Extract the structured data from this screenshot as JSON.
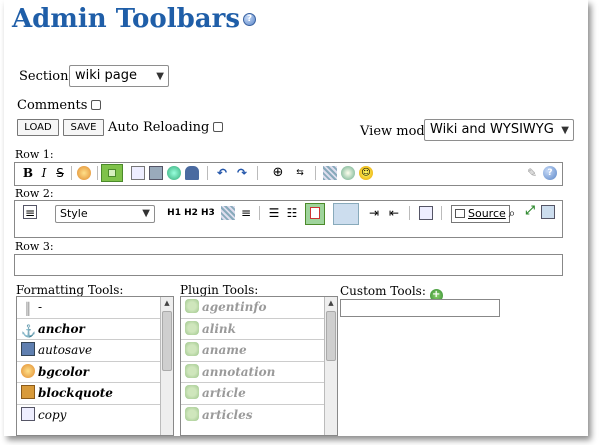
{
  "page": {
    "title": "Admin Toolbars",
    "section_label": "Section:",
    "section_value": "wiki page",
    "comments_label": "Comments",
    "load_label": "LOAD",
    "save_label": "SAVE",
    "auto_reloading_label": "Auto Reloading",
    "view_mode_label": "View mode",
    "view_mode_value": "Wiki and WYSIWYG"
  },
  "rows": {
    "row1_label": "Row 1:",
    "row2_label": "Row 2:",
    "row3_label": "Row 3:",
    "row2_style_value": "Style",
    "row2_source_label": "Source"
  },
  "row1_icons": [
    "bold-icon",
    "italic-icon",
    "strikethrough-icon",
    "color-icon",
    "box-icon",
    "copy-icon",
    "save-icon",
    "image-icon",
    "person-icon",
    "undo-icon",
    "redo-icon",
    "find-icon",
    "replace-icon",
    "table-icon",
    "globe-icon",
    "smiley-icon",
    "edit-icon",
    "help-icon"
  ],
  "row2_icons": [
    "document-icon",
    "h1-icon",
    "h2-icon",
    "h3-icon",
    "hr-icon",
    "align-icon",
    "bullet-list-icon",
    "numbered-list-icon",
    "flash-icon",
    "box2-icon",
    "indent-icon",
    "outdent-icon",
    "page-icon",
    "source-icon",
    "zoom-icon",
    "fullscreen-icon"
  ],
  "formatting": {
    "title": "Formatting Tools:",
    "items": [
      "-",
      "anchor",
      "autosave",
      "bgcolor",
      "blockquote",
      "copy"
    ]
  },
  "plugins": {
    "title": "Plugin Tools:",
    "items": [
      "agentinfo",
      "alink",
      "aname",
      "annotation",
      "article",
      "articles"
    ]
  },
  "custom": {
    "title": "Custom Tools:"
  },
  "colors": {
    "title": "#1f5ea8",
    "accent": "#2f8a2f"
  }
}
